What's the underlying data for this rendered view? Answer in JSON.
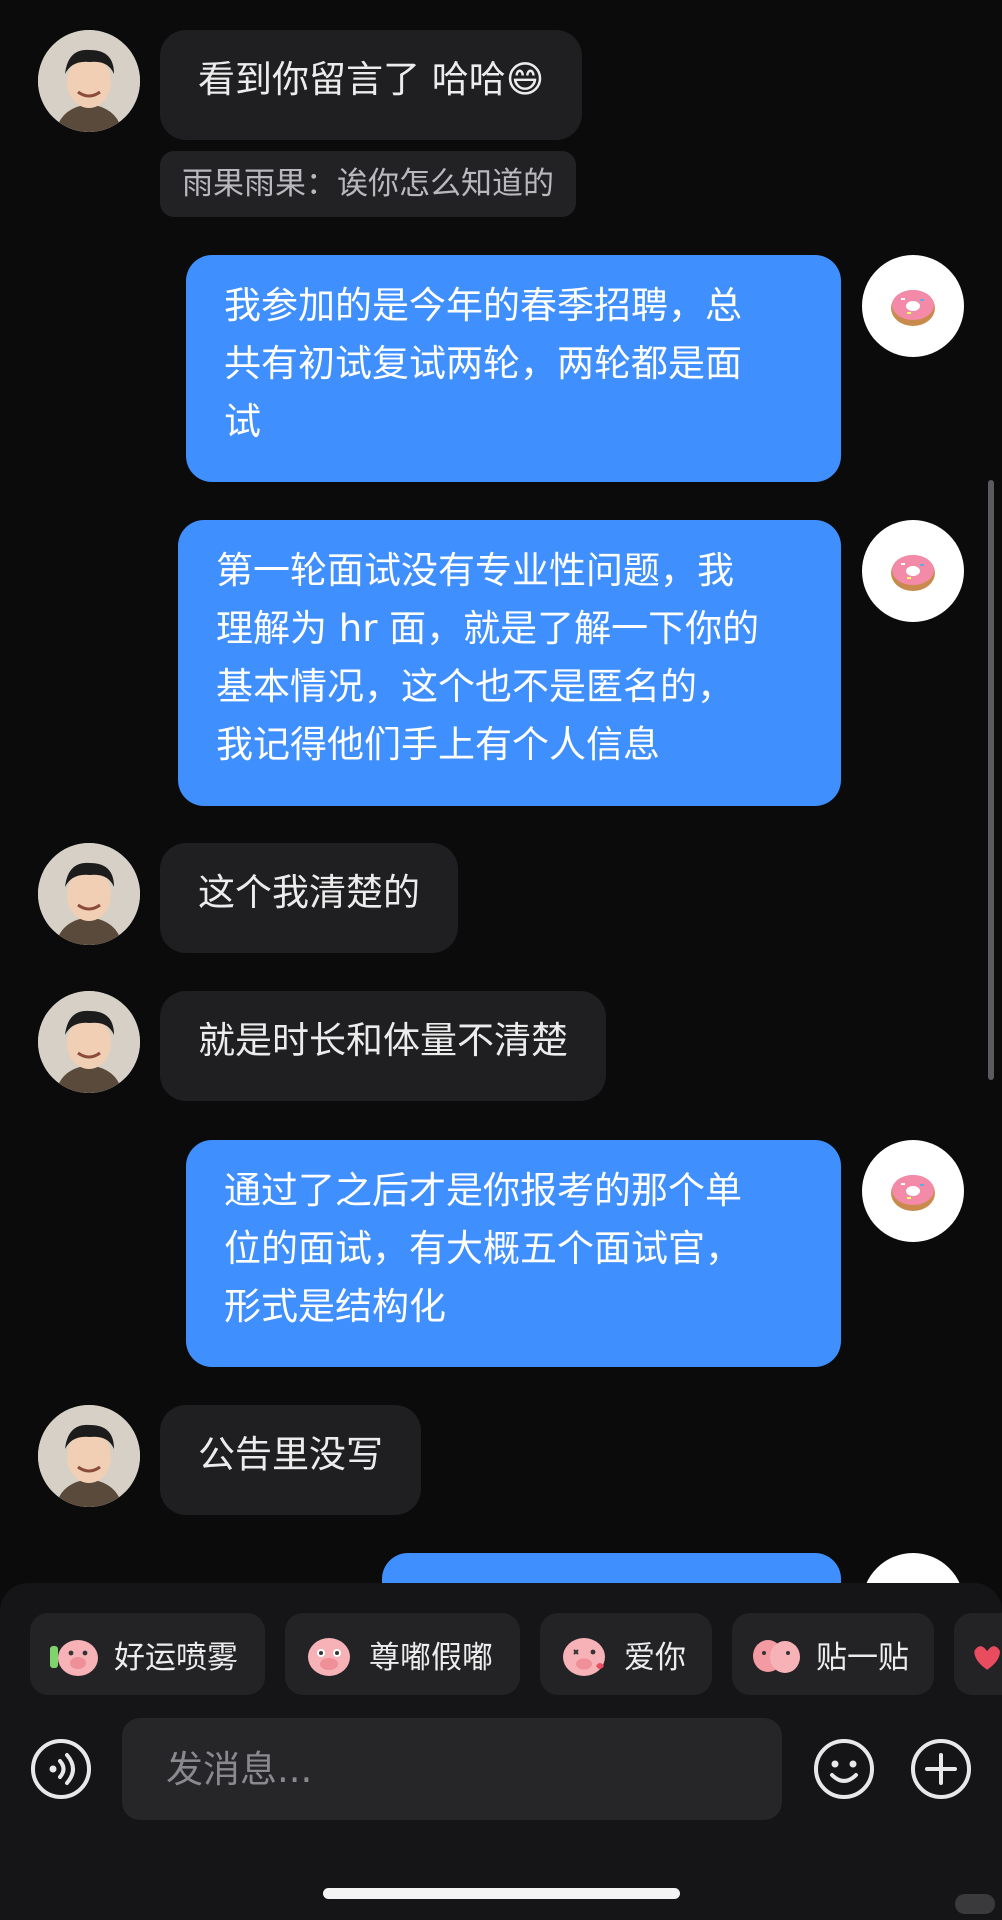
{
  "messages": [
    {
      "side": "in",
      "text": "看到你留言了 哈哈😄"
    },
    {
      "side": "in",
      "quote": "雨果雨果：诶你怎么知道的"
    },
    {
      "side": "out",
      "lines": [
        "我参加的是今年的春季招聘，总",
        "共有初试复试两轮，两轮都是面",
        "试"
      ]
    },
    {
      "side": "out",
      "lines": [
        "第一轮面试没有专业性问题，我",
        "理解为 hr 面，就是了解一下你的",
        "基本情况，这个也不是匿名的，",
        "我记得他们手上有个人信息"
      ]
    },
    {
      "side": "in",
      "text": "这个我清楚的"
    },
    {
      "side": "in",
      "text": "就是时长和体量不清楚"
    },
    {
      "side": "out",
      "lines": [
        "通过了之后才是你报考的那个单",
        "位的面试，有大概五个面试官，",
        "形式是结构化"
      ]
    },
    {
      "side": "in",
      "text": "公告里没写"
    }
  ],
  "quick_stickers": [
    {
      "label": "好运喷雾",
      "icon": "pig-spray-sticker-icon"
    },
    {
      "label": "尊嘟假嘟",
      "icon": "pig-face-sticker-icon"
    },
    {
      "label": "爱你",
      "icon": "pig-love-sticker-icon"
    },
    {
      "label": "贴一贴",
      "icon": "pig-hug-sticker-icon"
    }
  ],
  "composer": {
    "placeholder": "发消息...",
    "voice_icon": "voice-icon",
    "emoji_icon": "emoji-icon",
    "plus_icon": "plus-icon"
  },
  "colors": {
    "background": "#0b0b0c",
    "incoming_bubble": "#1f1f21",
    "outgoing_bubble": "#3f8ffe",
    "panel": "#151517"
  }
}
